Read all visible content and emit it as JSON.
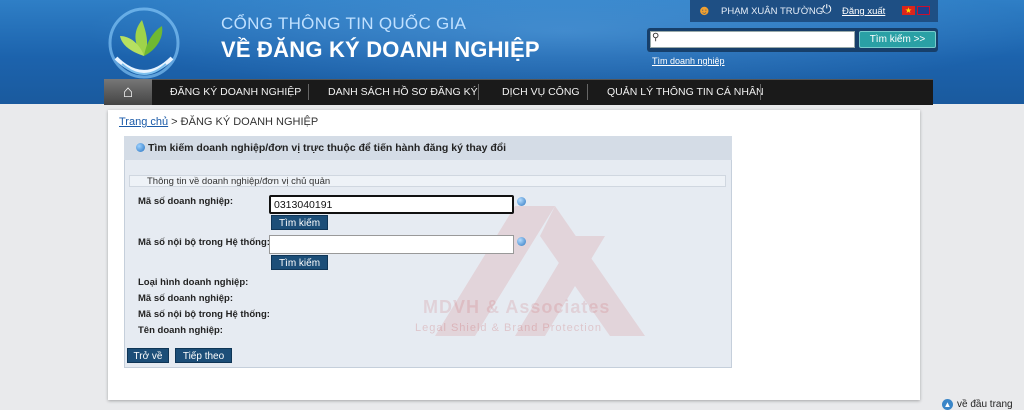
{
  "header": {
    "title_line1": "CỔNG THÔNG TIN QUỐC GIA",
    "title_line2": "VỀ ĐĂNG KÝ DOANH NGHIỆP",
    "user_name": "PHẠM XUÂN TRƯỜNG",
    "logout_label": "Đăng xuất",
    "search_placeholder": "",
    "search_button": "Tìm kiếm >>",
    "search_link": "Tìm doanh nghiệp"
  },
  "nav": {
    "items": [
      {
        "label": "ĐĂNG KÝ DOANH NGHIỆP"
      },
      {
        "label": "DANH SÁCH HỒ SƠ ĐĂNG KÝ"
      },
      {
        "label": "DỊCH VỤ CÔNG"
      },
      {
        "label": "QUẢN LÝ THÔNG TIN CÁ NHÂN"
      }
    ]
  },
  "breadcrumb": {
    "home": "Trang chủ",
    "separator": " > ",
    "current": "ĐĂNG KÝ DOANH NGHIỆP"
  },
  "panel": {
    "title": "Tìm kiếm doanh nghiệp/đơn vị trực thuộc để tiến hành đăng ký thay đổi",
    "section_title": "Thông tin về doanh nghiệp/đơn vị chủ quản",
    "fields": {
      "enterprise_code_label": "Mã số doanh nghiệp:",
      "enterprise_code_value": "0313040191",
      "internal_code_label": "Mã số nội bộ trong Hệ thống:",
      "internal_code_value": ""
    },
    "search_button": "Tìm kiếm",
    "results": {
      "type_label": "Loại hình doanh nghiệp:",
      "code_label": "Mã số doanh nghiệp:",
      "internal_label": "Mã số nội bộ trong Hệ thống:",
      "name_label": "Tên doanh nghiệp:"
    },
    "back_button": "Trở về",
    "next_button": "Tiếp theo"
  },
  "watermark": {
    "title": "MDVH & Associates",
    "subtitle": "Legal Shield & Brand Protection"
  },
  "footer": {
    "to_top": "về đầu trang"
  },
  "icons": {
    "home": "home-icon",
    "user": "user-icon",
    "power": "power-icon",
    "search": "search-icon",
    "info": "info-icon"
  },
  "colors": {
    "header_blue": "#1c63ad",
    "nav_dark": "#1a1a1a",
    "button_navy": "#1c4e78",
    "search_teal": "#2aa0a5"
  }
}
